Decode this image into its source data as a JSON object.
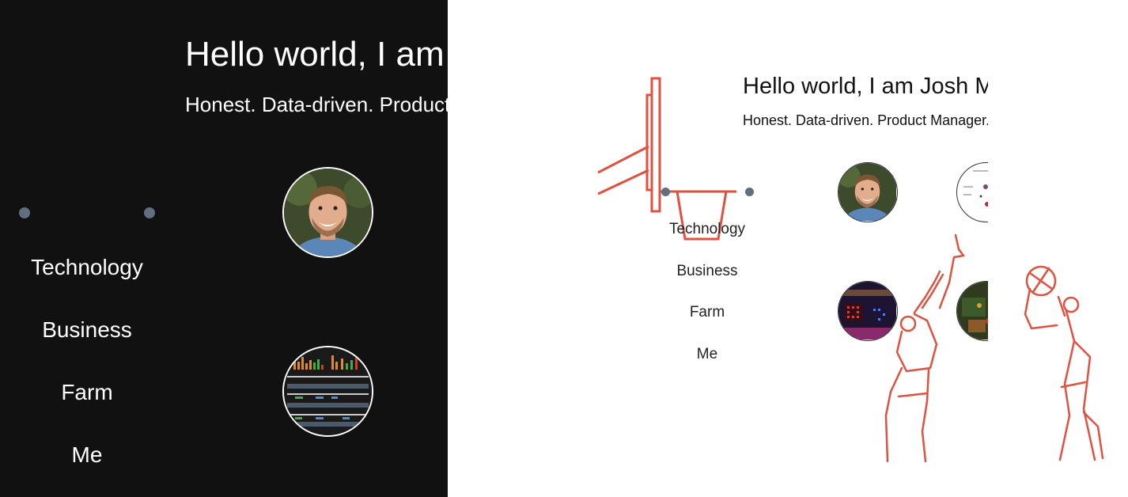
{
  "before": {
    "theme": "dark",
    "header": {
      "title": "Hello world, I am Josh M",
      "subtitle": "Honest. Data-driven. Product Manager."
    },
    "nav": [
      "Technology",
      "Business",
      "Farm",
      "Me"
    ],
    "tiles": [
      {
        "name": "profile-photo",
        "icon": "portrait-photo"
      },
      {
        "name": "dashboard-screenshot",
        "icon": "dashboard-thumbnail"
      }
    ]
  },
  "arrow": {
    "icon": "right-arrow-icon"
  },
  "after": {
    "theme": "light",
    "header": {
      "title": "Hello world, I am Josh M",
      "subtitle": "Honest. Data-driven. Product Manager."
    },
    "nav": [
      "Technology",
      "Business",
      "Farm",
      "Me"
    ],
    "tiles": [
      {
        "name": "profile-photo",
        "icon": "portrait-photo"
      },
      {
        "name": "document-thumbnail",
        "icon": "document-thumbnail"
      },
      {
        "name": "led-display-photo",
        "icon": "led-photo"
      },
      {
        "name": "circuit-board-photo",
        "icon": "circuit-photo"
      }
    ],
    "decor": {
      "hoop": "basketball-hoop-icon",
      "players": "basketball-players-illustration",
      "accent": "#e0513f"
    }
  },
  "colors": {
    "dark_bg": "#111111",
    "dot": "#5f6f80",
    "accent": "#e0513f"
  }
}
